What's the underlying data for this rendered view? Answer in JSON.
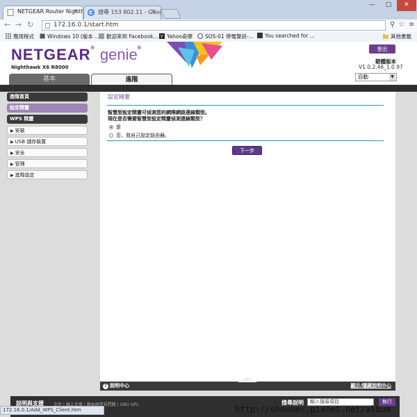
{
  "browser": {
    "tabs": [
      {
        "title": "NETGEAR Router Nighth",
        "active": true
      },
      {
        "title": "搜尋 153 802.11 - Goog",
        "active": false
      }
    ],
    "url": "172.16.0.1/start.htm",
    "bookmarks": [
      {
        "label": "應用程式",
        "icon": "apps-icon"
      },
      {
        "label": "Windows 10 (版本 ...",
        "icon": "page-icon"
      },
      {
        "label": "歡迎來到 Facebook...",
        "icon": "facebook-icon"
      },
      {
        "label": "Yahoo奇摩",
        "icon": "yahoo-icon"
      },
      {
        "label": "SOS-01 停電警訊-...",
        "icon": "alert-icon"
      },
      {
        "label": "You searched for ...",
        "icon": "page-icon"
      },
      {
        "label": "其他書籤",
        "icon": "folder-icon"
      }
    ],
    "status_url": "172.16.0.1/Add_WPS_Client.htm"
  },
  "header": {
    "brand": "NETGEAR",
    "product": "genie",
    "model": "Nighthawk X6 R8000",
    "logout_label": "登出",
    "firmware_label": "韌體版本",
    "firmware_version": "V1.0.2.46_1.0.97",
    "language": "自動"
  },
  "main_tabs": {
    "basic": "基本",
    "advanced": "進階"
  },
  "sidebar": {
    "items": [
      {
        "label": "進階首頁",
        "style": "dark"
      },
      {
        "label": "設定精靈",
        "style": "selected"
      },
      {
        "label": "WPS 精靈",
        "style": "dark"
      },
      {
        "label": "安裝",
        "style": "collapsible"
      },
      {
        "label": "USB 儲存裝置",
        "style": "collapsible"
      },
      {
        "label": "安全",
        "style": "collapsible"
      },
      {
        "label": "管理",
        "style": "collapsible"
      },
      {
        "label": "進階設定",
        "style": "collapsible"
      }
    ]
  },
  "wizard": {
    "title": "設定精靈",
    "question_1": "智慧型設定精靈可偵測您的網際網路連線類型。",
    "question_2": "現在是否需要智慧型設定精靈偵測連線類型？",
    "option_yes": "是",
    "option_no": "否，我自己設定路由器。",
    "selected": "yes",
    "next_label": "下一步"
  },
  "help_bar": {
    "help_center": "說明中心",
    "show_hide": "顯示/隱藏說明中心"
  },
  "footer": {
    "help_support": "說明與支援",
    "links": "文件 | 線上支援 | 路由器常見問題 | GNU GPL",
    "search_label": "搜尋說明",
    "search_placeholder": "輸入搜尋項目",
    "search_button": "執行"
  },
  "watermark": "http://showmer.pixnet.net/album",
  "colors": {
    "brand_purple": "#5a2a82",
    "accent_blue": "#1e93c9",
    "sidebar_selected": "#9b86b5"
  }
}
